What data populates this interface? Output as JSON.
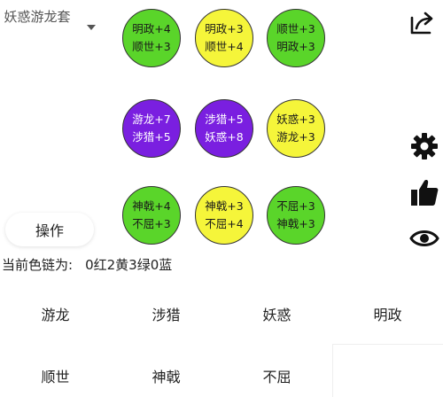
{
  "set_selector": {
    "value": "妖惑游龙套"
  },
  "circles": [
    {
      "color": "green",
      "lines": [
        "明政+4",
        "顺世+3"
      ]
    },
    {
      "color": "yellow",
      "lines": [
        "明政+3",
        "顺世+4"
      ]
    },
    {
      "color": "green",
      "lines": [
        "顺世+3",
        "明政+3"
      ]
    },
    {
      "color": "purple",
      "lines": [
        "游龙+7",
        "涉猎+5"
      ]
    },
    {
      "color": "purple",
      "lines": [
        "涉猎+5",
        "妖惑+8"
      ]
    },
    {
      "color": "yellow",
      "lines": [
        "妖惑+3",
        "游龙+3"
      ]
    },
    {
      "color": "green",
      "lines": [
        "神戟+4",
        "不屈+3"
      ]
    },
    {
      "color": "yellow",
      "lines": [
        "神戟+3",
        "不屈+4"
      ]
    },
    {
      "color": "green",
      "lines": [
        "不屈+3",
        "神戟+3"
      ]
    }
  ],
  "actions": {
    "operate_label": "操作"
  },
  "chain": {
    "label": "当前色链为:",
    "value": "0红2黄3绿0蓝"
  },
  "attributes": [
    "游龙",
    "涉猎",
    "妖惑",
    "明政",
    "顺世",
    "神戟",
    "不屈"
  ],
  "icons": {
    "share": "share-icon",
    "settings": "gear-icon",
    "like": "thumbs-up-icon",
    "view": "eye-icon"
  },
  "colors": {
    "green": "#5ad52a",
    "yellow": "#f5f53a",
    "purple": "#7a1fe0"
  }
}
